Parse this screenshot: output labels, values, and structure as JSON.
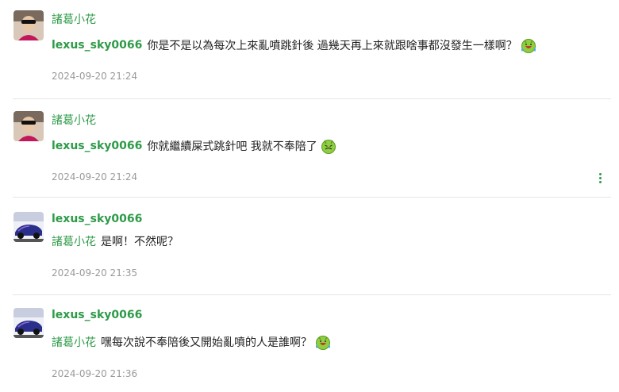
{
  "comments": [
    {
      "author": "諸葛小花",
      "mention": "lexus_sky0066",
      "text": "你是不是以為每次上來亂噴跳針後 過幾天再上來就跟啥事都沒發生一樣啊？",
      "emoji": "sweat-laugh-emoji",
      "time": "2024-09-20 21:24"
    },
    {
      "author": "諸葛小花",
      "mention": "lexus_sky0066",
      "text": "你就繼續屎式跳針吧 我就不奉陪了",
      "emoji": "disgusted-emoji",
      "time": "2024-09-20 21:24"
    },
    {
      "author": "lexus_sky0066",
      "mention": "諸葛小花",
      "text": "是啊！不然呢？",
      "time": "2024-09-20 21:35"
    },
    {
      "author": "lexus_sky0066",
      "mention": "諸葛小花",
      "text": "嘿每次說不奉陪後又開始亂噴的人是誰啊？",
      "emoji": "sweat-laugh-emoji",
      "time": "2024-09-20 21:36"
    }
  ]
}
